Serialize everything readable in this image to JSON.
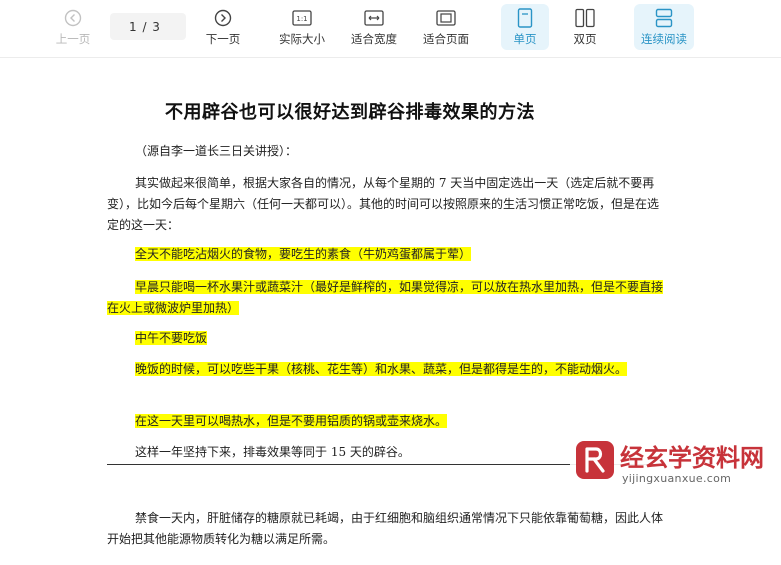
{
  "toolbar": {
    "prev_label": "上一页",
    "page_indicator": "1 / 3",
    "next_label": "下一页",
    "actual_size_label": "实际大小",
    "actual_size_glyph": "1:1",
    "fit_width_label": "适合宽度",
    "fit_page_label": "适合页面",
    "single_page_label": "单页",
    "double_page_label": "双页",
    "continuous_label": "连续阅读",
    "accent_color": "#2a94c6"
  },
  "document": {
    "title": "不用辟谷也可以很好达到辟谷排毒效果的方法",
    "source": "（源自李一道长三日关讲授）：",
    "intro": "其实做起来很简单，根据大家各自的情况，从每个星期的 7 天当中固定选出一天（选定后就不要再变），比如今后每个星期六（任何一天都可以）。其他的时间可以按照原来的生活习惯正常吃饭，但是在选定的这一天：",
    "rule1": "全天不能吃沾烟火的食物，要吃生的素食（牛奶鸡蛋都属于荤）",
    "rule2": "早晨只能喝一杯水果汁或蔬菜汁（最好是鲜榨的，如果觉得凉，可以放在热水里加热，但是不要直接在火上或微波炉里加热）",
    "rule3": "中午不要吃饭",
    "rule4": "晚饭的时候，可以吃些干果（核桃、花生等）和水果、蔬菜，但是都得是生的，不能动烟火。",
    "rule5": "在这一天里可以喝热水，但是不要用铝质的锅或壶来烧水。",
    "conclusion": "这样一年坚持下来，排毒效果等同于 15 天的辟谷。",
    "para2": "禁食一天内，肝脏储存的糖原就已耗竭，由于红细胞和脑组织通常情况下只能依靠葡萄糖，因此人体开始把其他能源物质转化为糖以满足所需。",
    "highlight_color": "#ffff00"
  },
  "watermark": {
    "title": "经玄学资料网",
    "url": "yijingxuanxue.com",
    "color": "#c7333a"
  }
}
